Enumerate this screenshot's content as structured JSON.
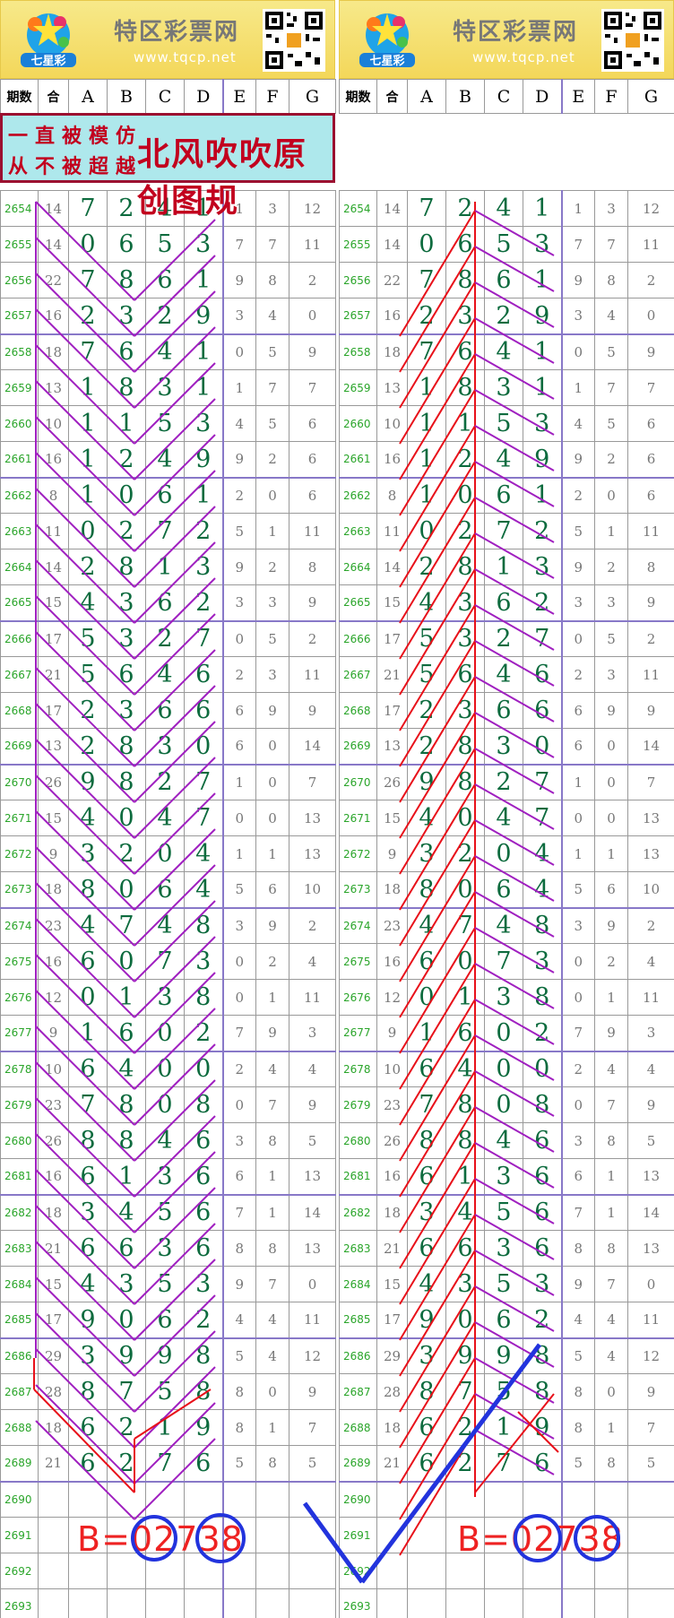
{
  "site": {
    "name": "特区彩票网",
    "url": "www.tqcp.net",
    "logo_text": "七星彩"
  },
  "header": [
    "期数",
    "合",
    "A",
    "B",
    "C",
    "D",
    "E",
    "F",
    "G"
  ],
  "slogan": {
    "line1": "一直被模仿",
    "line2": "从不被超越",
    "title": "北风吹吹原创图规"
  },
  "rows": [
    {
      "id": "2654",
      "s": "14",
      "a": "7",
      "b": "2",
      "c": "4",
      "d": "1",
      "e": "1",
      "f": "3",
      "g": "12"
    },
    {
      "id": "2655",
      "s": "14",
      "a": "0",
      "b": "6",
      "c": "5",
      "d": "3",
      "e": "7",
      "f": "7",
      "g": "11"
    },
    {
      "id": "2656",
      "s": "22",
      "a": "7",
      "b": "8",
      "c": "6",
      "d": "1",
      "e": "9",
      "f": "8",
      "g": "2"
    },
    {
      "id": "2657",
      "s": "16",
      "a": "2",
      "b": "3",
      "c": "2",
      "d": "9",
      "e": "3",
      "f": "4",
      "g": "0"
    },
    {
      "id": "2658",
      "s": "18",
      "a": "7",
      "b": "6",
      "c": "4",
      "d": "1",
      "e": "0",
      "f": "5",
      "g": "9"
    },
    {
      "id": "2659",
      "s": "13",
      "a": "1",
      "b": "8",
      "c": "3",
      "d": "1",
      "e": "1",
      "f": "7",
      "g": "7"
    },
    {
      "id": "2660",
      "s": "10",
      "a": "1",
      "b": "1",
      "c": "5",
      "d": "3",
      "e": "4",
      "f": "5",
      "g": "6"
    },
    {
      "id": "2661",
      "s": "16",
      "a": "1",
      "b": "2",
      "c": "4",
      "d": "9",
      "e": "9",
      "f": "2",
      "g": "6"
    },
    {
      "id": "2662",
      "s": "8",
      "a": "1",
      "b": "0",
      "c": "6",
      "d": "1",
      "e": "2",
      "f": "0",
      "g": "6"
    },
    {
      "id": "2663",
      "s": "11",
      "a": "0",
      "b": "2",
      "c": "7",
      "d": "2",
      "e": "5",
      "f": "1",
      "g": "11"
    },
    {
      "id": "2664",
      "s": "14",
      "a": "2",
      "b": "8",
      "c": "1",
      "d": "3",
      "e": "9",
      "f": "2",
      "g": "8"
    },
    {
      "id": "2665",
      "s": "15",
      "a": "4",
      "b": "3",
      "c": "6",
      "d": "2",
      "e": "3",
      "f": "3",
      "g": "9"
    },
    {
      "id": "2666",
      "s": "17",
      "a": "5",
      "b": "3",
      "c": "2",
      "d": "7",
      "e": "0",
      "f": "5",
      "g": "2"
    },
    {
      "id": "2667",
      "s": "21",
      "a": "5",
      "b": "6",
      "c": "4",
      "d": "6",
      "e": "2",
      "f": "3",
      "g": "11"
    },
    {
      "id": "2668",
      "s": "17",
      "a": "2",
      "b": "3",
      "c": "6",
      "d": "6",
      "e": "6",
      "f": "9",
      "g": "9"
    },
    {
      "id": "2669",
      "s": "13",
      "a": "2",
      "b": "8",
      "c": "3",
      "d": "0",
      "e": "6",
      "f": "0",
      "g": "14"
    },
    {
      "id": "2670",
      "s": "26",
      "a": "9",
      "b": "8",
      "c": "2",
      "d": "7",
      "e": "1",
      "f": "0",
      "g": "7"
    },
    {
      "id": "2671",
      "s": "15",
      "a": "4",
      "b": "0",
      "c": "4",
      "d": "7",
      "e": "0",
      "f": "0",
      "g": "13"
    },
    {
      "id": "2672",
      "s": "9",
      "a": "3",
      "b": "2",
      "c": "0",
      "d": "4",
      "e": "1",
      "f": "1",
      "g": "13"
    },
    {
      "id": "2673",
      "s": "18",
      "a": "8",
      "b": "0",
      "c": "6",
      "d": "4",
      "e": "5",
      "f": "6",
      "g": "10"
    },
    {
      "id": "2674",
      "s": "23",
      "a": "4",
      "b": "7",
      "c": "4",
      "d": "8",
      "e": "3",
      "f": "9",
      "g": "2"
    },
    {
      "id": "2675",
      "s": "16",
      "a": "6",
      "b": "0",
      "c": "7",
      "d": "3",
      "e": "0",
      "f": "2",
      "g": "4"
    },
    {
      "id": "2676",
      "s": "12",
      "a": "0",
      "b": "1",
      "c": "3",
      "d": "8",
      "e": "0",
      "f": "1",
      "g": "11"
    },
    {
      "id": "2677",
      "s": "9",
      "a": "1",
      "b": "6",
      "c": "0",
      "d": "2",
      "e": "7",
      "f": "9",
      "g": "3"
    },
    {
      "id": "2678",
      "s": "10",
      "a": "6",
      "b": "4",
      "c": "0",
      "d": "0",
      "e": "2",
      "f": "4",
      "g": "4"
    },
    {
      "id": "2679",
      "s": "23",
      "a": "7",
      "b": "8",
      "c": "0",
      "d": "8",
      "e": "0",
      "f": "7",
      "g": "9"
    },
    {
      "id": "2680",
      "s": "26",
      "a": "8",
      "b": "8",
      "c": "4",
      "d": "6",
      "e": "3",
      "f": "8",
      "g": "5"
    },
    {
      "id": "2681",
      "s": "16",
      "a": "6",
      "b": "1",
      "c": "3",
      "d": "6",
      "e": "6",
      "f": "1",
      "g": "13"
    },
    {
      "id": "2682",
      "s": "18",
      "a": "3",
      "b": "4",
      "c": "5",
      "d": "6",
      "e": "7",
      "f": "1",
      "g": "14"
    },
    {
      "id": "2683",
      "s": "21",
      "a": "6",
      "b": "6",
      "c": "3",
      "d": "6",
      "e": "8",
      "f": "8",
      "g": "13"
    },
    {
      "id": "2684",
      "s": "15",
      "a": "4",
      "b": "3",
      "c": "5",
      "d": "3",
      "e": "9",
      "f": "7",
      "g": "0"
    },
    {
      "id": "2685",
      "s": "17",
      "a": "9",
      "b": "0",
      "c": "6",
      "d": "2",
      "e": "4",
      "f": "4",
      "g": "11"
    },
    {
      "id": "2686",
      "s": "29",
      "a": "3",
      "b": "9",
      "c": "9",
      "d": "8",
      "e": "5",
      "f": "4",
      "g": "12"
    },
    {
      "id": "2687",
      "s": "28",
      "a": "8",
      "b": "7",
      "c": "5",
      "d": "8",
      "e": "8",
      "f": "0",
      "g": "9"
    },
    {
      "id": "2688",
      "s": "18",
      "a": "6",
      "b": "2",
      "c": "1",
      "d": "9",
      "e": "8",
      "f": "1",
      "g": "7"
    },
    {
      "id": "2689",
      "s": "21",
      "a": "6",
      "b": "2",
      "c": "7",
      "d": "6",
      "e": "5",
      "f": "8",
      "g": "5"
    },
    {
      "id": "2690",
      "s": "",
      "a": "",
      "b": "",
      "c": "",
      "d": "",
      "e": "",
      "f": "",
      "g": ""
    },
    {
      "id": "2691",
      "s": "",
      "a": "",
      "b": "",
      "c": "",
      "d": "",
      "e": "",
      "f": "",
      "g": ""
    },
    {
      "id": "2692",
      "s": "",
      "a": "",
      "b": "",
      "c": "",
      "d": "",
      "e": "",
      "f": "",
      "g": ""
    },
    {
      "id": "2693",
      "s": "",
      "a": "",
      "b": "",
      "c": "",
      "d": "",
      "e": "",
      "f": "",
      "g": ""
    }
  ],
  "answer_left": "B=02738",
  "answer_right": "B=02738",
  "colors": {
    "banner": "#f3d75a",
    "digit": "#0d6b3e",
    "period": "#2aa52a",
    "slogan_bg": "#aee8ec",
    "slogan_text": "#c2001e",
    "line_purple": "#a020c0",
    "line_red": "#e8111a",
    "circle_blue": "#2233dd"
  }
}
